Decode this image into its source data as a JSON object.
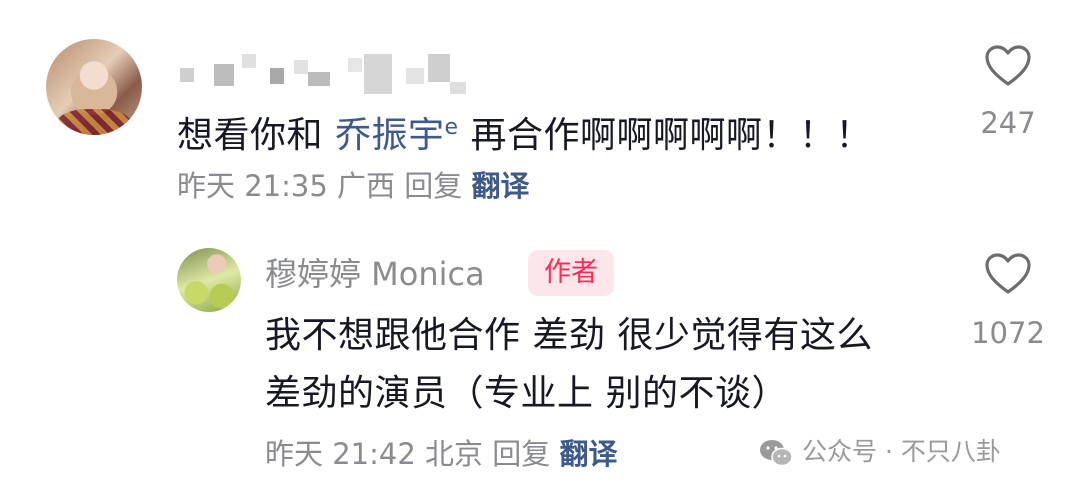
{
  "comment": {
    "username": "",
    "text_before": "想看你和 ",
    "mention": "乔振宇",
    "text_after": " 再合作啊啊啊啊啊！！！",
    "time": "昨天 21:35",
    "location": "广西",
    "reply_label": "回复",
    "translate_label": "翻译",
    "likes": "247"
  },
  "reply": {
    "username": "穆婷婷 Monica",
    "author_badge": "作者",
    "text_line1": "我不想跟他合作 差劲 很少觉得有这么",
    "text_line2": "差劲的演员（专业上 别的不谈）",
    "time": "昨天 21:42",
    "location": "北京",
    "reply_label": "回复",
    "translate_label": "翻译",
    "likes": "1072"
  },
  "watermark": {
    "text": "公众号 · 不只八卦"
  },
  "colors": {
    "accent_link": "#3d5a8a",
    "badge_text": "#fe2c55",
    "badge_bg": "#fde6ea",
    "meta_gray": "#8a8b91"
  },
  "icons": [
    "heart-outline-icon",
    "search-icon",
    "wechat-icon"
  ]
}
